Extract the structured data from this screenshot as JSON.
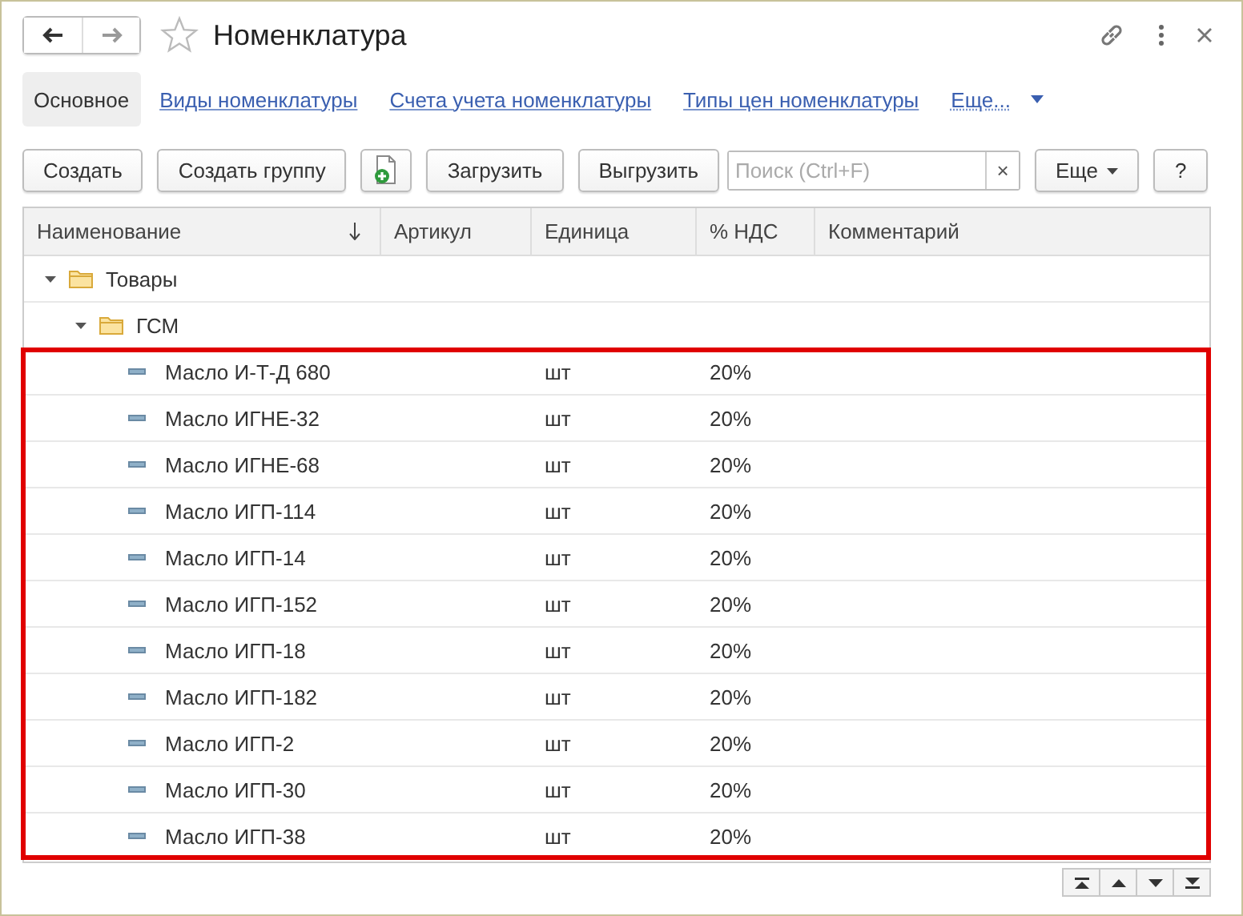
{
  "window": {
    "title": "Номенклатура",
    "favorite": false
  },
  "tabs": [
    {
      "label": "Основное",
      "selected": true,
      "kind": "tab"
    },
    {
      "label": "Виды номенклатуры",
      "selected": false,
      "kind": "tab"
    },
    {
      "label": "Счета учета номенклатуры",
      "selected": false,
      "kind": "tab"
    },
    {
      "label": "Типы цен номенклатуры",
      "selected": false,
      "kind": "tab"
    },
    {
      "label": "Еще...",
      "selected": false,
      "kind": "more"
    }
  ],
  "toolbar": [
    {
      "kind": "button",
      "label": "Создать"
    },
    {
      "kind": "button",
      "label": "Создать группу"
    },
    {
      "kind": "icon"
    },
    {
      "kind": "button",
      "label": "Загрузить"
    },
    {
      "kind": "button",
      "label": "Выгрузить"
    },
    {
      "kind": "search",
      "placeholder": "Поиск (Ctrl+F)",
      "clear": "×"
    },
    {
      "kind": "menu",
      "label": "Еще"
    },
    {
      "kind": "button",
      "label": "?"
    }
  ],
  "table": {
    "columns": [
      {
        "label": "Наименование",
        "sorted": true
      },
      {
        "label": "Артикул",
        "sorted": false
      },
      {
        "label": "Единица",
        "sorted": false
      },
      {
        "label": "% НДС",
        "sorted": false
      },
      {
        "label": "Комментарий",
        "sorted": false
      }
    ],
    "rows": [
      {
        "name": "Товары",
        "kind": "group",
        "expanded": true,
        "children": [
          {
            "name": "ГСМ",
            "kind": "group",
            "expanded": true,
            "highlighted": true,
            "children": [
              {
                "name": "Масло И-Т-Д 680",
                "kind": "item",
                "unit": "шт",
                "vat": "20%"
              },
              {
                "name": "Масло ИГНЕ-32",
                "kind": "item",
                "unit": "шт",
                "vat": "20%"
              },
              {
                "name": "Масло ИГНЕ-68",
                "kind": "item",
                "unit": "шт",
                "vat": "20%"
              },
              {
                "name": "Масло ИГП-114",
                "kind": "item",
                "unit": "шт",
                "vat": "20%"
              },
              {
                "name": "Масло ИГП-14",
                "kind": "item",
                "unit": "шт",
                "vat": "20%"
              },
              {
                "name": "Масло ИГП-152",
                "kind": "item",
                "unit": "шт",
                "vat": "20%"
              },
              {
                "name": "Масло ИГП-18",
                "kind": "item",
                "unit": "шт",
                "vat": "20%"
              },
              {
                "name": "Масло ИГП-182",
                "kind": "item",
                "unit": "шт",
                "vat": "20%"
              },
              {
                "name": "Масло ИГП-2",
                "kind": "item",
                "unit": "шт",
                "vat": "20%"
              },
              {
                "name": "Масло ИГП-30",
                "kind": "item",
                "unit": "шт",
                "vat": "20%"
              },
              {
                "name": "Масло ИГП-38",
                "kind": "item",
                "unit": "шт",
                "vat": "20%"
              }
            ]
          }
        ]
      }
    ]
  }
}
